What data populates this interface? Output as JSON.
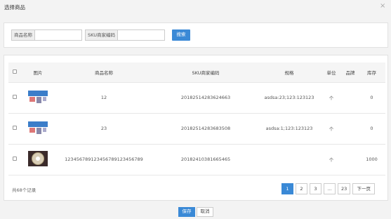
{
  "dialog": {
    "title": "选择商品",
    "close_glyph": "×"
  },
  "search": {
    "name_label": "商品名称",
    "name_value": "",
    "sku_label": "SKU商家编码",
    "sku_value": "",
    "button_label": "搜索"
  },
  "table": {
    "headers": [
      "图片",
      "商品名称",
      "SKU商家编码",
      "规格",
      "单位",
      "品牌",
      "库存"
    ],
    "rows": [
      {
        "image": "product-screen-image",
        "name": "12",
        "sku": "20182514283624663",
        "spec": "asdsa:23;123:123123",
        "unit": "个",
        "brand": "",
        "stock": "0"
      },
      {
        "image": "product-screen-image",
        "name": "23",
        "sku": "20182514283683508",
        "spec": "asdsa:1;123:123123",
        "unit": "个",
        "brand": "",
        "stock": "0"
      },
      {
        "image": "product-clock-image",
        "name": "12345678912345678912345678​9",
        "sku": "20182410381665465",
        "spec": "",
        "unit": "个",
        "brand": "",
        "stock": "1000"
      }
    ]
  },
  "footer": {
    "total_text": "共68个记录",
    "pages": [
      "1",
      "2",
      "3",
      "...",
      "23"
    ],
    "active_page": "1",
    "next_label": "下一页"
  },
  "actions": {
    "save_label": "保存",
    "cancel_label": "取消"
  },
  "colors": {
    "accent": "#3a89d6",
    "background": "#f3f3f3"
  }
}
